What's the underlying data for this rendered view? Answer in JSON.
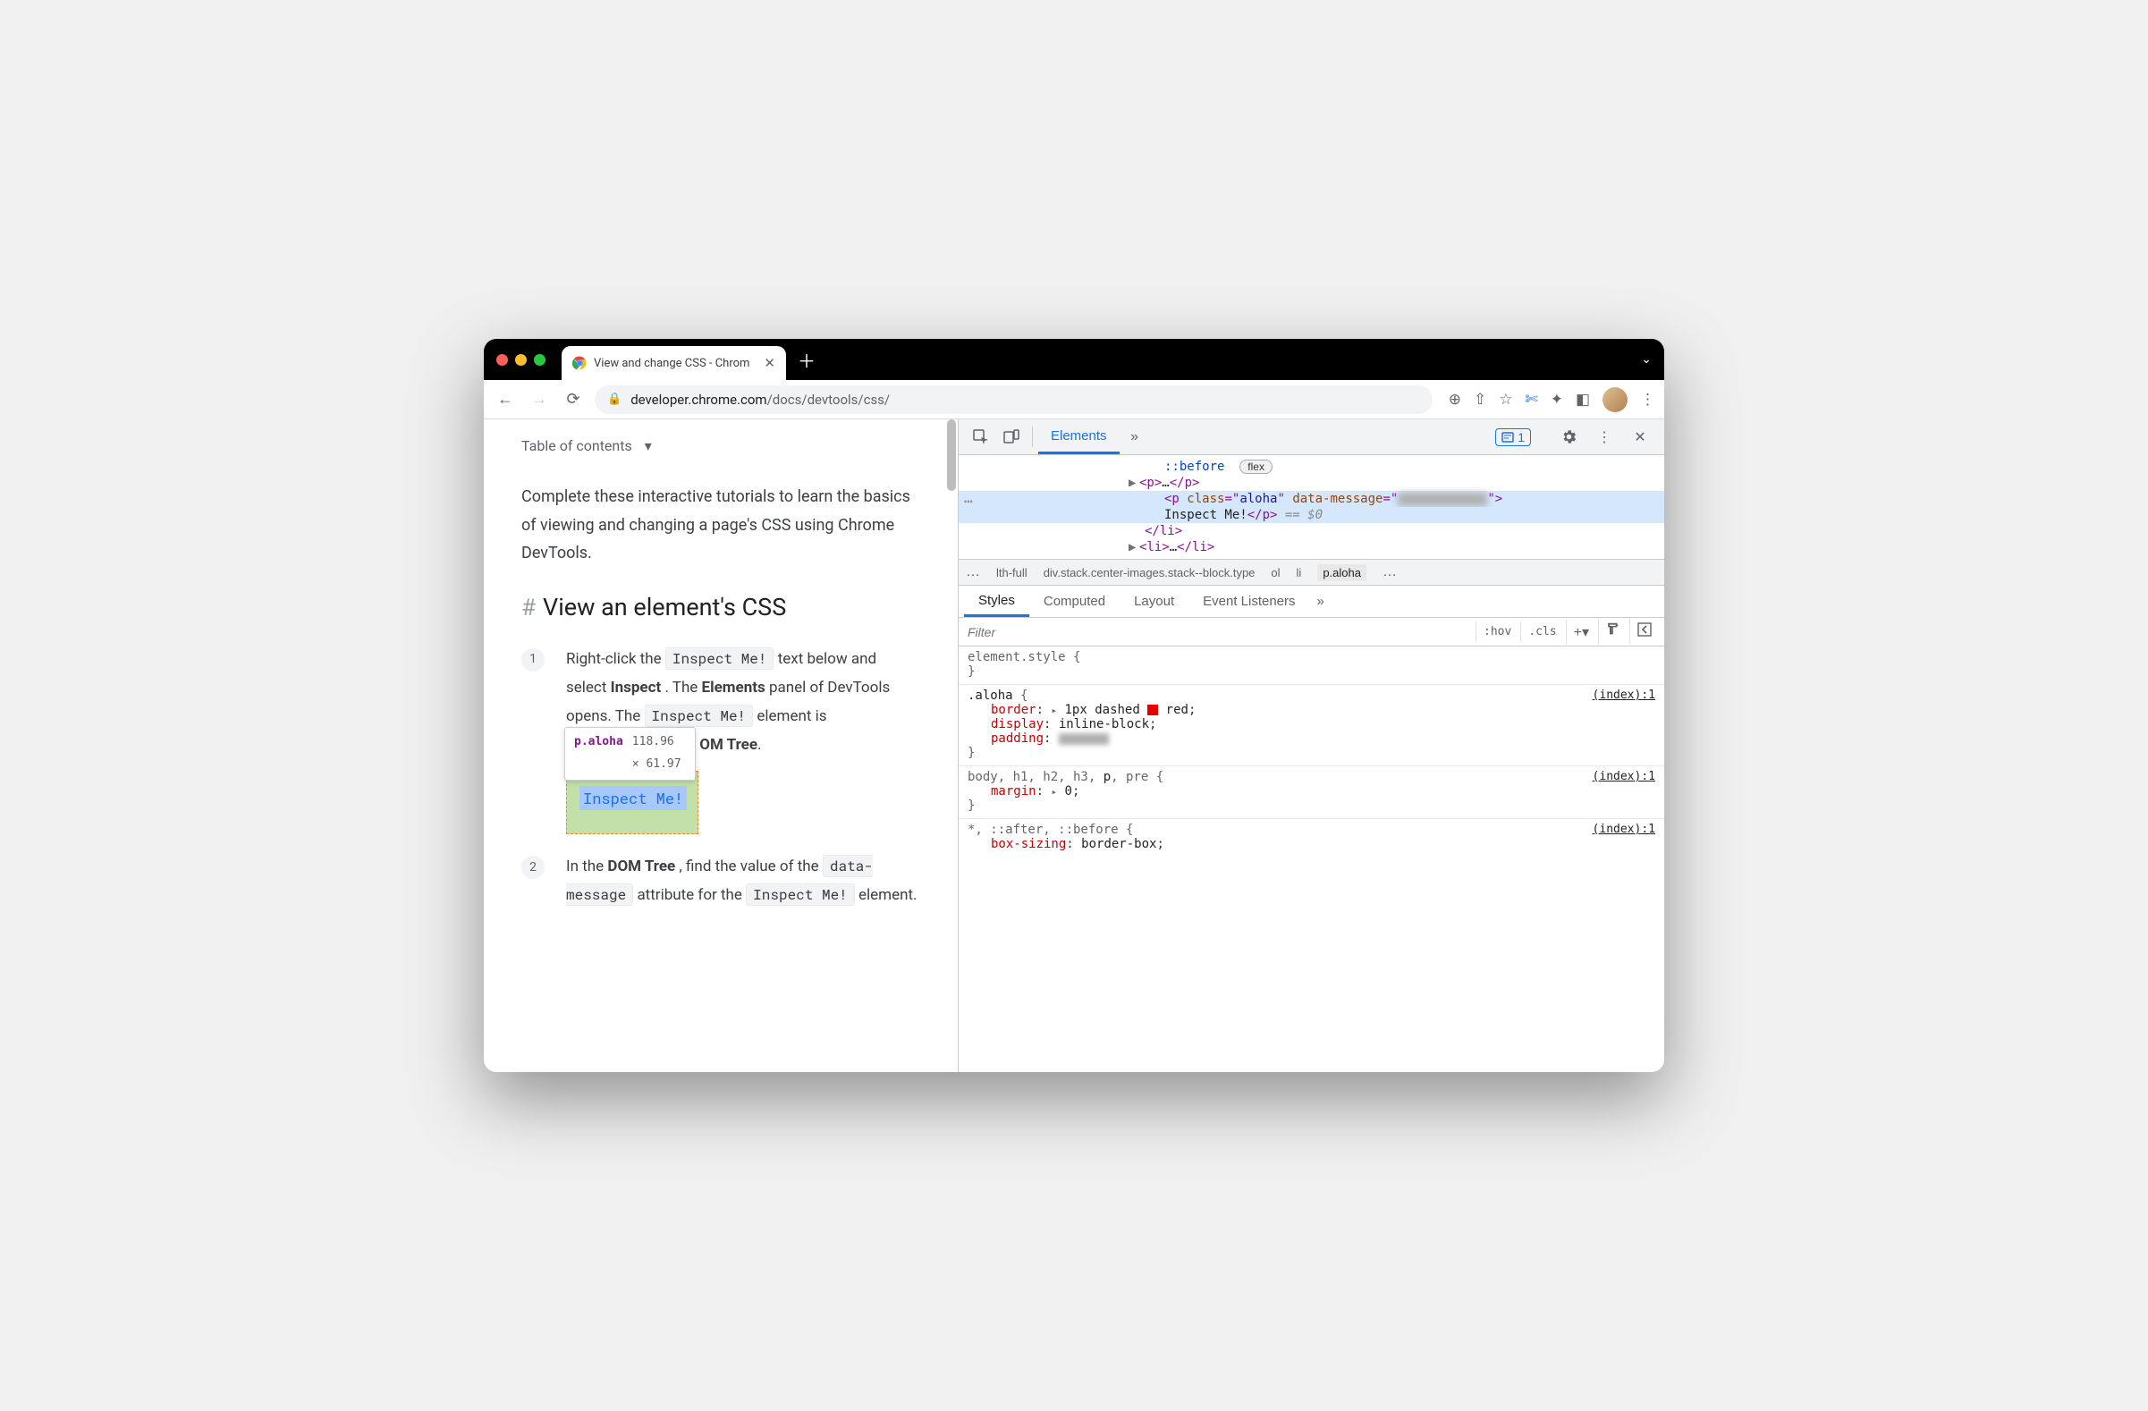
{
  "browser": {
    "tab_title": "View and change CSS - Chrom",
    "url_host": "developer.chrome.com",
    "url_path": "/docs/devtools/css/"
  },
  "page": {
    "toc_label": "Table of contents",
    "intro": "Complete these interactive tutorials to learn the basics of viewing and changing a page's CSS using Chrome DevTools.",
    "heading": "View an element's CSS",
    "step1_a": "Right-click the ",
    "step1_code1": "Inspect Me!",
    "step1_b": " text below and select ",
    "step1_bold1": "Inspect",
    "step1_c": ". The ",
    "step1_bold2": "Elements",
    "step1_d": " panel of DevTools opens. The ",
    "step1_code2": "Inspect Me!",
    "step1_e": " element is ",
    "step1_tail": "OM Tree",
    "step1_period": ".",
    "tooltip_sel": "p.aloha",
    "tooltip_dim": "118.96 × 61.97",
    "inspect_box": "Inspect Me!",
    "step2_a": "In the ",
    "step2_bold": "DOM Tree",
    "step2_b": ", find the value of the ",
    "step2_code1": "data-message",
    "step2_c": " attribute for the ",
    "step2_code2": "Inspect Me!",
    "step2_d": " element."
  },
  "devtools": {
    "tab_elements": "Elements",
    "issues_count": "1",
    "dom": {
      "before": "::before",
      "flex": "flex",
      "p_collapsed": "…",
      "p_tag_open": "<p",
      "class_attr": "class",
      "class_val": "aloha",
      "data_attr": "data-message",
      "text": "Inspect Me!",
      "p_close": "</p>",
      "eq_dollar": "== $0",
      "li_close": "</li>",
      "li_collapsed": "…"
    },
    "crumbs": {
      "c1": "lth-full",
      "c2": "div.stack.center-images.stack--block.type",
      "c3": "ol",
      "c4": "li",
      "c5": "p.aloha"
    },
    "styles_tabs": {
      "styles": "Styles",
      "computed": "Computed",
      "layout": "Layout",
      "events": "Event Listeners"
    },
    "filter_placeholder": "Filter",
    "filter_tools": {
      "hov": ":hov",
      "cls": ".cls"
    },
    "rules": {
      "element_style": "element.style",
      "aloha_sel": ".aloha",
      "aloha_link": "(index):1",
      "border_prop": "border",
      "border_val": "1px dashed ",
      "border_color": "red",
      "display_prop": "display",
      "display_val": "inline-block",
      "padding_prop": "padding",
      "body_sel": "body, h1, h2, h3, ",
      "body_sel_p": "p",
      "body_sel_tail": ", pre",
      "body_link": "(index):1",
      "margin_prop": "margin",
      "margin_val": "0",
      "star_sel": "*, ::after, ::before",
      "star_link": "(index):1",
      "box_prop": "box-sizing",
      "box_val": "border-box"
    }
  }
}
